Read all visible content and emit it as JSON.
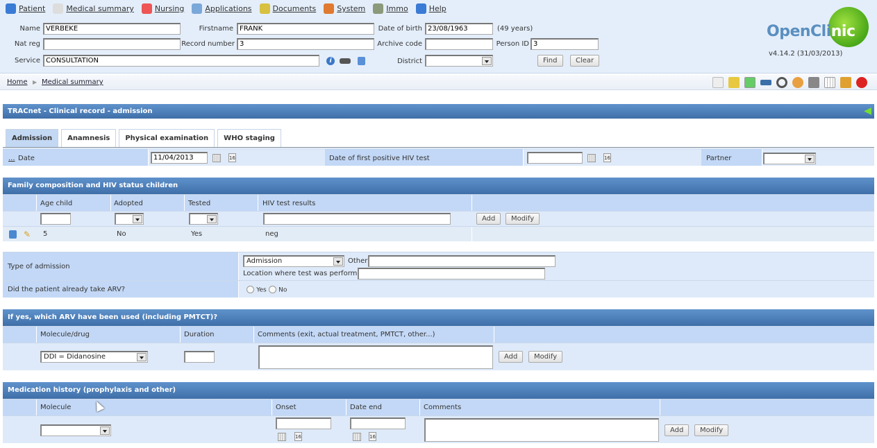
{
  "menu": [
    {
      "label": "Patient",
      "icon": "patient-icon",
      "color": "#3a7bd5"
    },
    {
      "label": "Medical summary",
      "icon": "clipboard-icon",
      "color": "#ddd"
    },
    {
      "label": "Nursing",
      "icon": "nursing-icon",
      "color": "#e55"
    },
    {
      "label": "Applications",
      "icon": "applications-icon",
      "color": "#7aa8d8"
    },
    {
      "label": "Documents",
      "icon": "folder-icon",
      "color": "#d8c040"
    },
    {
      "label": "System",
      "icon": "system-icon",
      "color": "#e07a30"
    },
    {
      "label": "Immo",
      "icon": "building-icon",
      "color": "#8a9a7a"
    },
    {
      "label": "Help",
      "icon": "help-icon",
      "color": "#3a7bd5"
    }
  ],
  "patient": {
    "name_label": "Name",
    "name": "VERBEKE",
    "firstname_label": "Firstname",
    "firstname": "FRANK",
    "dob_label": "Date of birth",
    "dob": "23/08/1963",
    "age": "(49 years)",
    "natreg_label": "Nat reg",
    "natreg": "",
    "record_label": "Record number",
    "record": "3",
    "archive_label": "Archive code",
    "archive": "",
    "personid_label": "Person ID",
    "personid": "3",
    "service_label": "Service",
    "service": "CONSULTATION",
    "district_label": "District",
    "district": "",
    "find": "Find",
    "clear": "Clear"
  },
  "logo": {
    "open": "OpenCli",
    "nic": "nic",
    "version": "v4.14.2 (31/03/2013)"
  },
  "breadcrumb": {
    "home": "Home",
    "current": "Medical summary"
  },
  "page": {
    "title": "TRACnet - Clinical record - admission"
  },
  "tabs": [
    "Admission",
    "Anamnesis",
    "Physical examination",
    "WHO staging"
  ],
  "admission": {
    "more": "...",
    "date_label": "Date",
    "date": "11/04/2013",
    "hiv_label": "Date of first positive HIV test",
    "hiv_date": "",
    "partner_label": "Partner",
    "partner": ""
  },
  "family": {
    "title": "Family composition and HIV status children",
    "cols": [
      "Age child",
      "Adopted",
      "Tested",
      "HIV test results"
    ],
    "rows": [
      {
        "age": "5",
        "adopted": "No",
        "tested": "Yes",
        "result": "neg"
      }
    ],
    "add": "Add",
    "modify": "Modify"
  },
  "typeadm": {
    "label": "Type of admission",
    "value": "Admission",
    "other_label": "Other",
    "other": "",
    "location_label": "Location where test was performed",
    "location": ""
  },
  "arv": {
    "label": "Did the patient already take ARV?",
    "yes": "Yes",
    "no": "No"
  },
  "arvused": {
    "title": "If yes, which ARV have been used (including PMTCT)?",
    "cols": [
      "Molecule/drug",
      "Duration",
      "Comments (exit, actual treatment, PMTCT, other...)"
    ],
    "molecule": "DDI = Didanosine",
    "duration": "",
    "add": "Add",
    "modify": "Modify"
  },
  "medhist": {
    "title": "Medication history (prophylaxis and other)",
    "cols": [
      "Molecule",
      "Onset",
      "Date end",
      "Comments"
    ],
    "add": "Add",
    "modify": "Modify"
  }
}
